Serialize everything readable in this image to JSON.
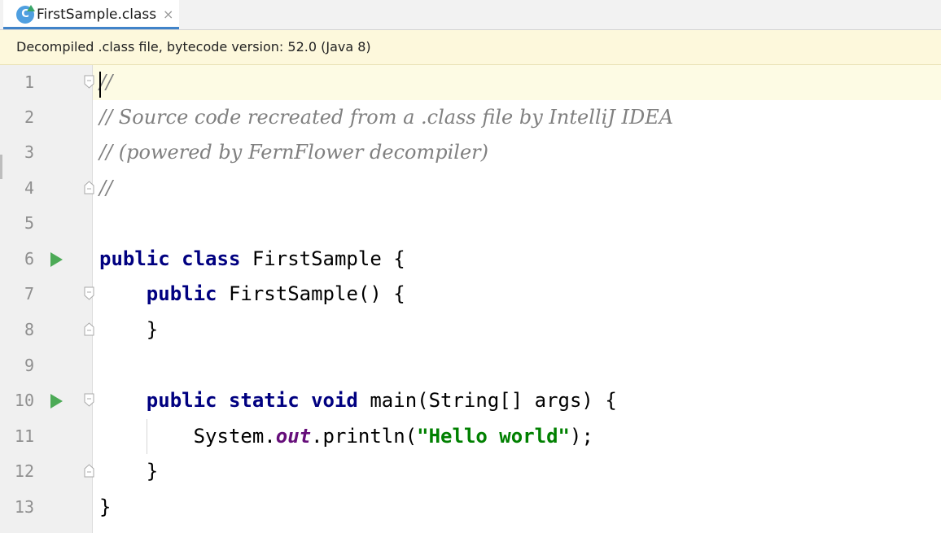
{
  "tab": {
    "icon_letter": "C",
    "label": "FirstSample.class",
    "close": "×"
  },
  "banner": {
    "text": "Decompiled .class file, bytecode version: 52.0 (Java 8)"
  },
  "editor": {
    "line_numbers": [
      "1",
      "2",
      "3",
      "4",
      "5",
      "6",
      "7",
      "8",
      "9",
      "10",
      "11",
      "12",
      "13"
    ],
    "lines": {
      "l1": "//",
      "l2": "// Source code recreated from a .class file by IntelliJ IDEA",
      "l3": "// (powered by FernFlower decompiler)",
      "l4": "//",
      "l6_kw": "public class",
      "l6_rest": " FirstSample {",
      "l7_indent": "    ",
      "l7_kw": "public",
      "l7_rest": " FirstSample() {",
      "l8": "    }",
      "l10_indent": "    ",
      "l10_kw": "public static void",
      "l10_rest": " main(String[] args) {",
      "l11_pre": "        System.",
      "l11_field": "out",
      "l11_mid": ".println(",
      "l11_str": "\"Hello world\"",
      "l11_post": ");",
      "l12": "    }",
      "l13": "}"
    }
  },
  "colors": {
    "keyword": "#000080",
    "comment": "#808080",
    "string": "#008000",
    "static_field": "#660e7a",
    "run_icon": "#4caa56",
    "banner_bg": "#fdf8dc"
  }
}
